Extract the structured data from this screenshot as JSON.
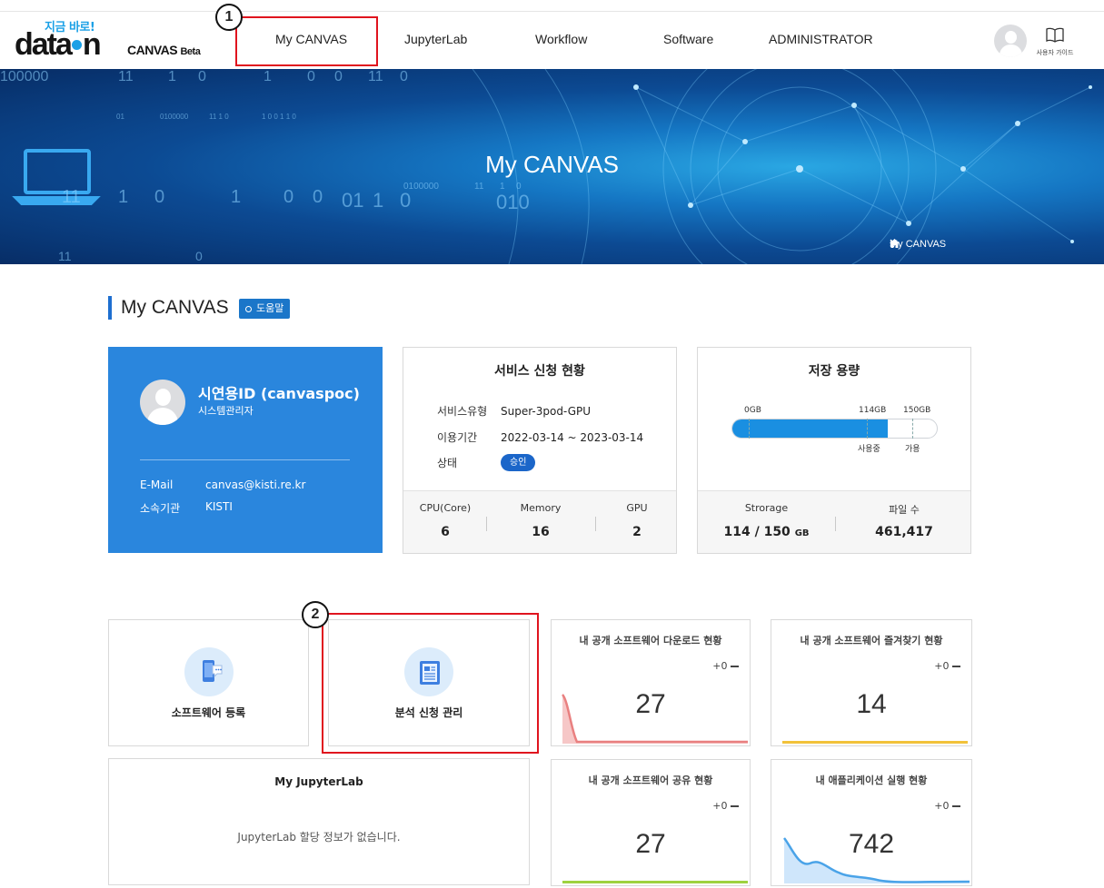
{
  "logo": {
    "tagline": "지금 바로!",
    "brand_left": "data",
    "brand_right": "n",
    "product": "CANVAS",
    "edition": "Beta"
  },
  "nav": {
    "items": [
      {
        "label": "My CANVAS"
      },
      {
        "label": "JupyterLab"
      },
      {
        "label": "Workflow"
      },
      {
        "label": "Software"
      },
      {
        "label": "ADMINISTRATOR"
      }
    ],
    "guide_label": "사용자 가이드"
  },
  "annotations": {
    "first": "1",
    "second": "2"
  },
  "banner": {
    "title": "My CANVAS",
    "breadcrumb_current": "My CANVAS",
    "binary_text": [
      "100000",
      "11",
      "1",
      "0",
      "1",
      "0",
      "0",
      "11",
      "0",
      "01",
      "0100000",
      "11 1 0",
      "1 0 0 1 1 0",
      "11",
      "1",
      "0",
      "1",
      "0",
      "0",
      "01",
      "1",
      "0",
      "0100000",
      "11",
      "1",
      "0",
      "010",
      "11",
      "0"
    ]
  },
  "section": {
    "title": "My CANVAS",
    "help_label": "도움말"
  },
  "profile": {
    "name": "시연용ID (canvaspoc)",
    "role": "시스템관리자",
    "email_label": "E-Mail",
    "email": "canvas@kisti.re.kr",
    "org_label": "소속기관",
    "org": "KISTI"
  },
  "service": {
    "title": "서비스 신청 현황",
    "type_label": "서비스유형",
    "type": "Super-3pod-GPU",
    "period_label": "이용기간",
    "period": "2022-03-14 ~ 2023-03-14",
    "status_label": "상태",
    "status": "승인",
    "cpu_label": "CPU(Core)",
    "cpu": "6",
    "memory_label": "Memory",
    "memory": "16",
    "gpu_label": "GPU",
    "gpu": "2"
  },
  "storage": {
    "title": "저장 용량",
    "min_label": "0GB",
    "used_label": "114GB",
    "max_label": "150GB",
    "used_caption": "사용중",
    "avail_caption": "가용",
    "used_fraction": 0.76,
    "storage_label": "Strorage",
    "storage_used": "114",
    "storage_sep": "/",
    "storage_total": "150",
    "storage_unit": "GB",
    "files_label": "파일 수",
    "files": "461,417"
  },
  "tiles": {
    "sw_register": "소프트웨어 등록",
    "analysis_manage": "분석 신청 관리",
    "jupyter_title": "My JupyterLab",
    "jupyter_empty": "JupyterLab 할당 정보가 없습니다."
  },
  "stats": [
    {
      "title": "내 공개 소프트웨어 다운로드 현황",
      "delta": "+0",
      "value": "27",
      "color": "#e98080"
    },
    {
      "title": "내 공개 소프트웨어 즐겨찾기 현황",
      "delta": "+0",
      "value": "14",
      "color": "#f2c23a"
    },
    {
      "title": "내 공개 소프트웨어 공유 현황",
      "delta": "+0",
      "value": "27",
      "color": "#9ed23f"
    },
    {
      "title": "내 애플리케이션 실행 현황",
      "delta": "+0",
      "value": "742",
      "color": "#4aa3e8"
    }
  ]
}
